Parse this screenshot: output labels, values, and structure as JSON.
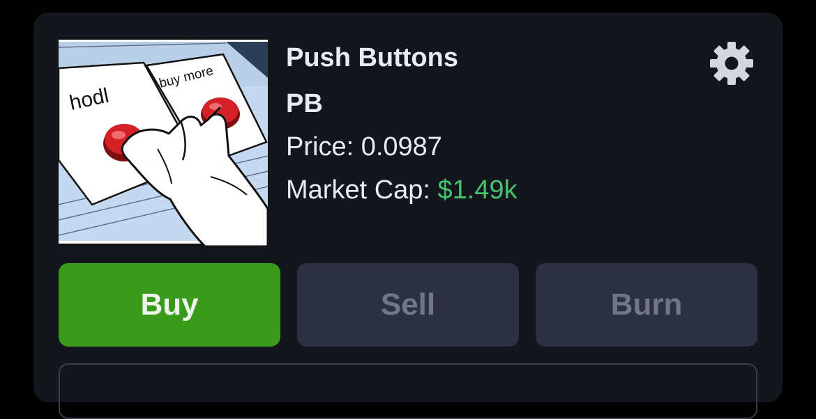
{
  "token": {
    "name": "Push Buttons",
    "symbol": "PB",
    "price_label": "Price:",
    "price_value": "0.0987",
    "market_cap_label": "Market Cap:",
    "market_cap_value": "$1.49k",
    "image": {
      "left_button_label": "hodl",
      "right_button_label": "buy more"
    }
  },
  "actions": {
    "buy_label": "Buy",
    "sell_label": "Sell",
    "burn_label": "Burn"
  },
  "icons": {
    "settings": "gear-icon"
  },
  "colors": {
    "card_background": "#14161d",
    "buy_button": "#399a1c",
    "inactive_button": "#2c3040",
    "market_cap_value": "#46c46d"
  }
}
